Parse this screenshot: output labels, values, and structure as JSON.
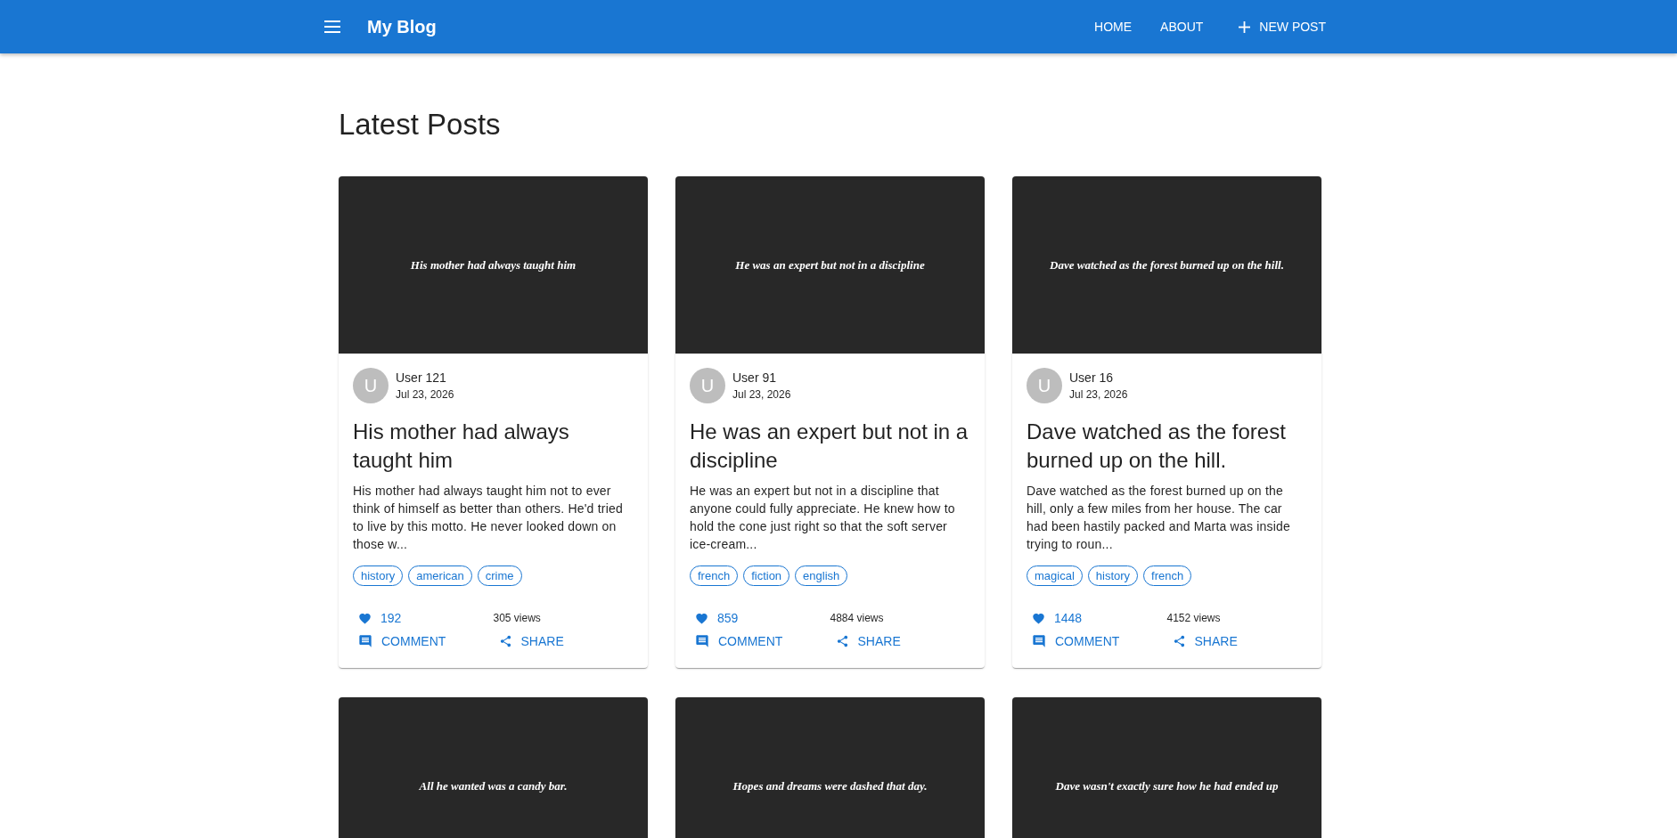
{
  "app_bar": {
    "title": "My Blog",
    "nav": [
      {
        "label": "HOME",
        "kind": "link"
      },
      {
        "label": "ABOUT",
        "kind": "link"
      },
      {
        "label": "NEW POST",
        "kind": "add"
      }
    ]
  },
  "heading": "Latest Posts",
  "posts": [
    {
      "cover_text": "His mother had always taught him",
      "avatar_letter": "U",
      "author": "User 121",
      "date": "Jul 23, 2026",
      "title": "His mother had always taught him",
      "excerpt": "His mother had always taught him not to ever think of himself as better than others. He'd tried to live by this motto. He never looked down on those w...",
      "tags": [
        "history",
        "american",
        "crime"
      ],
      "likes": "192",
      "views": "305 views",
      "comment": "COMMENT",
      "share": "SHARE"
    },
    {
      "cover_text": "He was an expert but not in a discipline",
      "avatar_letter": "U",
      "author": "User 91",
      "date": "Jul 23, 2026",
      "title": "He was an expert but not in a discipline",
      "excerpt": "He was an expert but not in a discipline that anyone could fully appreciate. He knew how to hold the cone just right so that the soft server ice-cream...",
      "tags": [
        "french",
        "fiction",
        "english"
      ],
      "likes": "859",
      "views": "4884 views",
      "comment": "COMMENT",
      "share": "SHARE"
    },
    {
      "cover_text": "Dave watched as the forest burned up on the hill.",
      "avatar_letter": "U",
      "author": "User 16",
      "date": "Jul 23, 2026",
      "title": "Dave watched as the forest burned up on the hill.",
      "excerpt": "Dave watched as the forest burned up on the hill, only a few miles from her house. The car had been hastily packed and Marta was inside trying to roun...",
      "tags": [
        "magical",
        "history",
        "french"
      ],
      "likes": "1448",
      "views": "4152 views",
      "comment": "COMMENT",
      "share": "SHARE"
    },
    {
      "cover_text": "All he wanted was a candy bar."
    },
    {
      "cover_text": "Hopes and dreams were dashed that day."
    },
    {
      "cover_text": "Dave wasn't exactly sure how he had ended up"
    }
  ]
}
